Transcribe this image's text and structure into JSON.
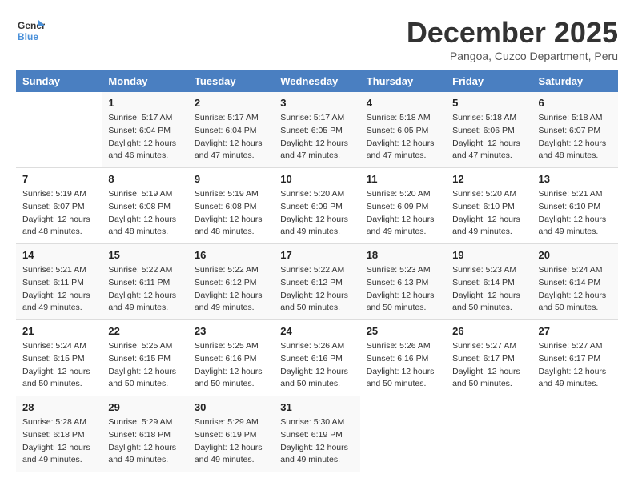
{
  "logo": {
    "line1": "General",
    "line2": "Blue"
  },
  "title": "December 2025",
  "subtitle": "Pangoa, Cuzco Department, Peru",
  "days_of_week": [
    "Sunday",
    "Monday",
    "Tuesday",
    "Wednesday",
    "Thursday",
    "Friday",
    "Saturday"
  ],
  "weeks": [
    [
      {
        "day": "",
        "sunrise": "",
        "sunset": "",
        "daylight": ""
      },
      {
        "day": "1",
        "sunrise": "5:17 AM",
        "sunset": "6:04 PM",
        "daylight": "12 hours and 46 minutes."
      },
      {
        "day": "2",
        "sunrise": "5:17 AM",
        "sunset": "6:04 PM",
        "daylight": "12 hours and 47 minutes."
      },
      {
        "day": "3",
        "sunrise": "5:17 AM",
        "sunset": "6:05 PM",
        "daylight": "12 hours and 47 minutes."
      },
      {
        "day": "4",
        "sunrise": "5:18 AM",
        "sunset": "6:05 PM",
        "daylight": "12 hours and 47 minutes."
      },
      {
        "day": "5",
        "sunrise": "5:18 AM",
        "sunset": "6:06 PM",
        "daylight": "12 hours and 47 minutes."
      },
      {
        "day": "6",
        "sunrise": "5:18 AM",
        "sunset": "6:07 PM",
        "daylight": "12 hours and 48 minutes."
      }
    ],
    [
      {
        "day": "7",
        "sunrise": "5:19 AM",
        "sunset": "6:07 PM",
        "daylight": "12 hours and 48 minutes."
      },
      {
        "day": "8",
        "sunrise": "5:19 AM",
        "sunset": "6:08 PM",
        "daylight": "12 hours and 48 minutes."
      },
      {
        "day": "9",
        "sunrise": "5:19 AM",
        "sunset": "6:08 PM",
        "daylight": "12 hours and 48 minutes."
      },
      {
        "day": "10",
        "sunrise": "5:20 AM",
        "sunset": "6:09 PM",
        "daylight": "12 hours and 49 minutes."
      },
      {
        "day": "11",
        "sunrise": "5:20 AM",
        "sunset": "6:09 PM",
        "daylight": "12 hours and 49 minutes."
      },
      {
        "day": "12",
        "sunrise": "5:20 AM",
        "sunset": "6:10 PM",
        "daylight": "12 hours and 49 minutes."
      },
      {
        "day": "13",
        "sunrise": "5:21 AM",
        "sunset": "6:10 PM",
        "daylight": "12 hours and 49 minutes."
      }
    ],
    [
      {
        "day": "14",
        "sunrise": "5:21 AM",
        "sunset": "6:11 PM",
        "daylight": "12 hours and 49 minutes."
      },
      {
        "day": "15",
        "sunrise": "5:22 AM",
        "sunset": "6:11 PM",
        "daylight": "12 hours and 49 minutes."
      },
      {
        "day": "16",
        "sunrise": "5:22 AM",
        "sunset": "6:12 PM",
        "daylight": "12 hours and 49 minutes."
      },
      {
        "day": "17",
        "sunrise": "5:22 AM",
        "sunset": "6:12 PM",
        "daylight": "12 hours and 50 minutes."
      },
      {
        "day": "18",
        "sunrise": "5:23 AM",
        "sunset": "6:13 PM",
        "daylight": "12 hours and 50 minutes."
      },
      {
        "day": "19",
        "sunrise": "5:23 AM",
        "sunset": "6:14 PM",
        "daylight": "12 hours and 50 minutes."
      },
      {
        "day": "20",
        "sunrise": "5:24 AM",
        "sunset": "6:14 PM",
        "daylight": "12 hours and 50 minutes."
      }
    ],
    [
      {
        "day": "21",
        "sunrise": "5:24 AM",
        "sunset": "6:15 PM",
        "daylight": "12 hours and 50 minutes."
      },
      {
        "day": "22",
        "sunrise": "5:25 AM",
        "sunset": "6:15 PM",
        "daylight": "12 hours and 50 minutes."
      },
      {
        "day": "23",
        "sunrise": "5:25 AM",
        "sunset": "6:16 PM",
        "daylight": "12 hours and 50 minutes."
      },
      {
        "day": "24",
        "sunrise": "5:26 AM",
        "sunset": "6:16 PM",
        "daylight": "12 hours and 50 minutes."
      },
      {
        "day": "25",
        "sunrise": "5:26 AM",
        "sunset": "6:16 PM",
        "daylight": "12 hours and 50 minutes."
      },
      {
        "day": "26",
        "sunrise": "5:27 AM",
        "sunset": "6:17 PM",
        "daylight": "12 hours and 50 minutes."
      },
      {
        "day": "27",
        "sunrise": "5:27 AM",
        "sunset": "6:17 PM",
        "daylight": "12 hours and 49 minutes."
      }
    ],
    [
      {
        "day": "28",
        "sunrise": "5:28 AM",
        "sunset": "6:18 PM",
        "daylight": "12 hours and 49 minutes."
      },
      {
        "day": "29",
        "sunrise": "5:29 AM",
        "sunset": "6:18 PM",
        "daylight": "12 hours and 49 minutes."
      },
      {
        "day": "30",
        "sunrise": "5:29 AM",
        "sunset": "6:19 PM",
        "daylight": "12 hours and 49 minutes."
      },
      {
        "day": "31",
        "sunrise": "5:30 AM",
        "sunset": "6:19 PM",
        "daylight": "12 hours and 49 minutes."
      },
      {
        "day": "",
        "sunrise": "",
        "sunset": "",
        "daylight": ""
      },
      {
        "day": "",
        "sunrise": "",
        "sunset": "",
        "daylight": ""
      },
      {
        "day": "",
        "sunrise": "",
        "sunset": "",
        "daylight": ""
      }
    ]
  ],
  "labels": {
    "sunrise_prefix": "Sunrise: ",
    "sunset_prefix": "Sunset: ",
    "daylight_prefix": "Daylight: "
  }
}
